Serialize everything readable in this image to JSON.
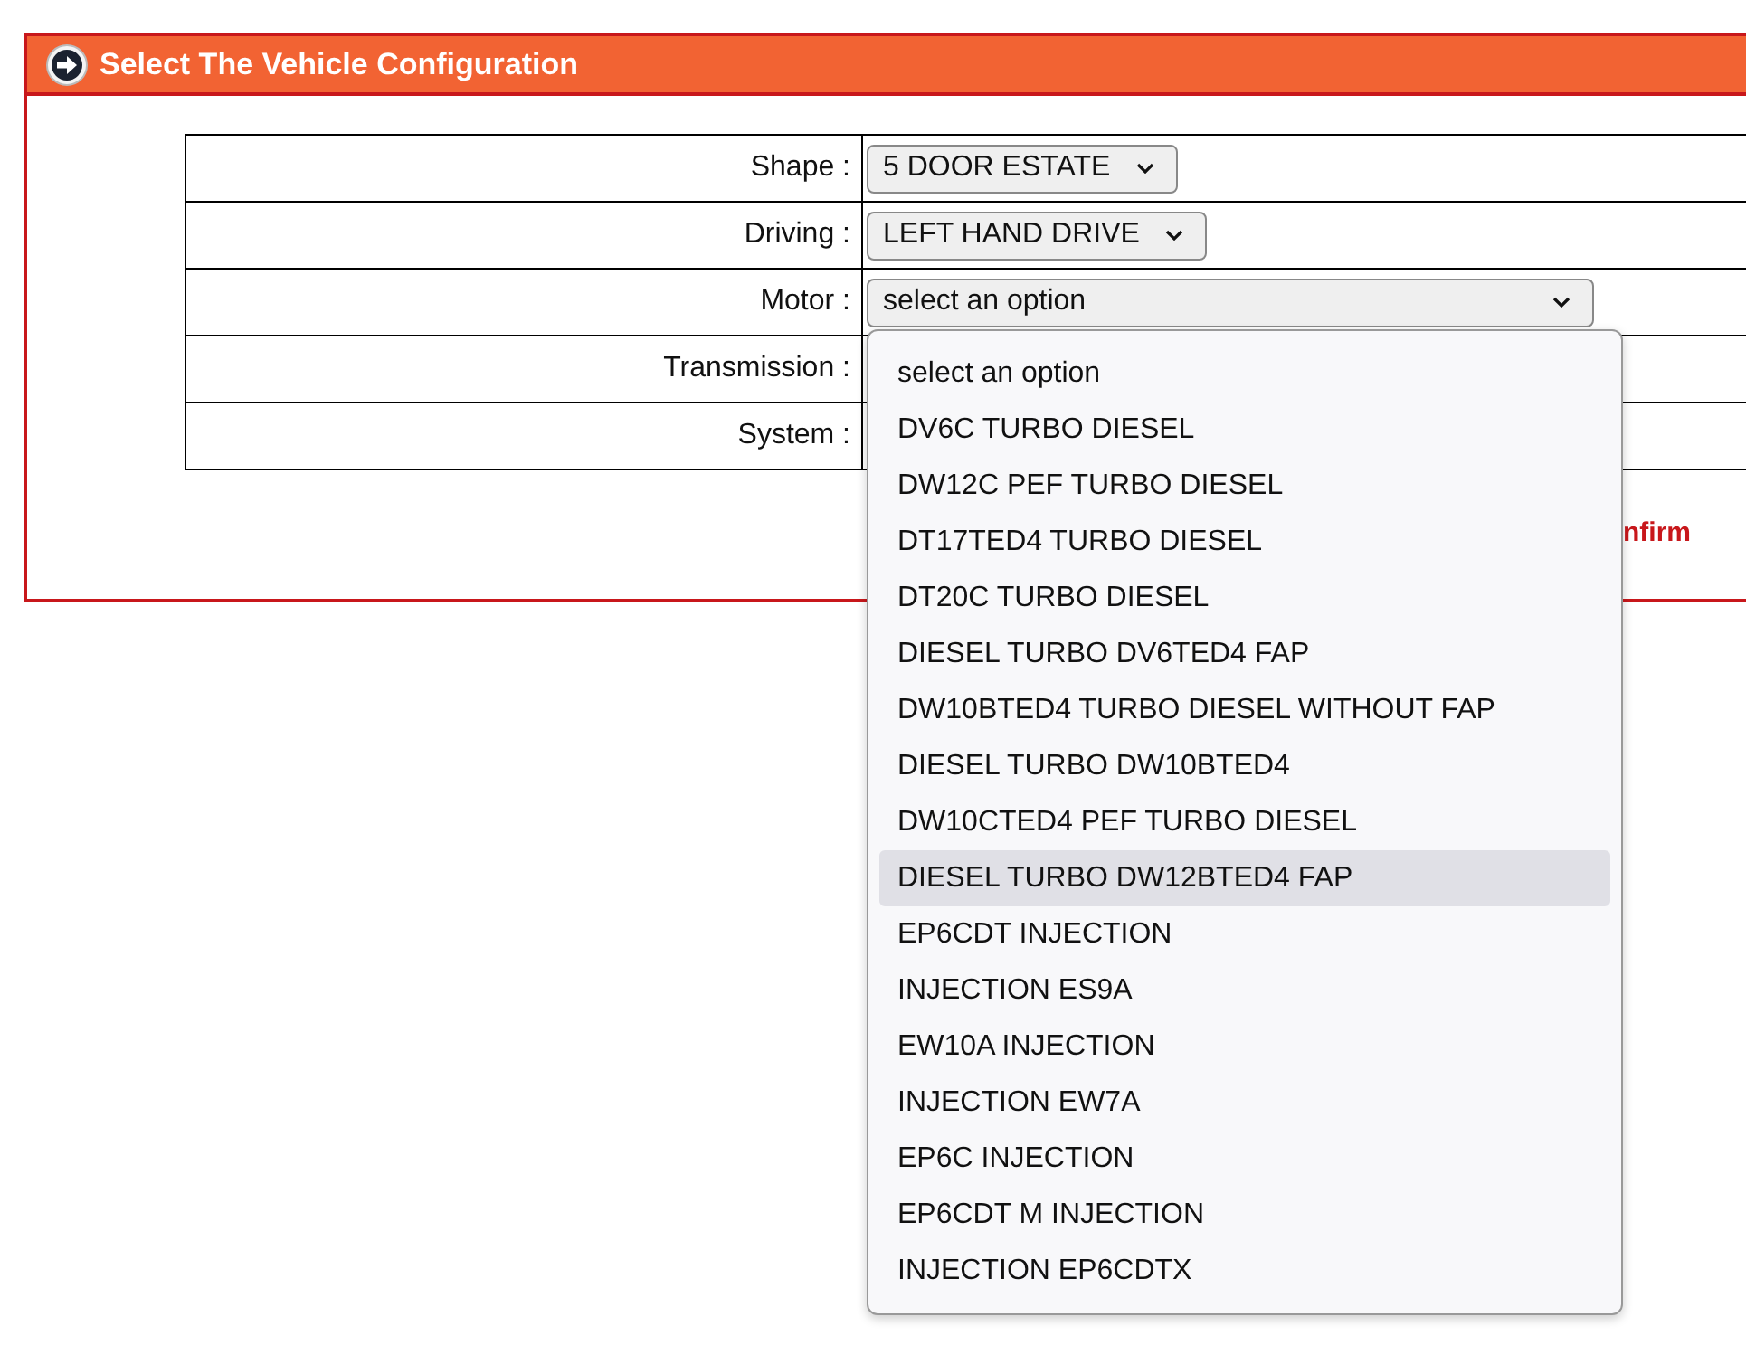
{
  "panel": {
    "title": "Select The Vehicle Configuration"
  },
  "rows": [
    {
      "label": "Shape :",
      "value": "5 DOOR ESTATE",
      "expanded": false
    },
    {
      "label": "Driving :",
      "value": "LEFT HAND DRIVE",
      "expanded": false
    },
    {
      "label": "Motor :",
      "value": "select an option",
      "expanded": true,
      "options": [
        {
          "text": "select an option",
          "highlighted": false
        },
        {
          "text": "DV6C TURBO DIESEL",
          "highlighted": false
        },
        {
          "text": "DW12C PEF TURBO DIESEL",
          "highlighted": false
        },
        {
          "text": "DT17TED4 TURBO DIESEL",
          "highlighted": false
        },
        {
          "text": "DT20C TURBO DIESEL",
          "highlighted": false
        },
        {
          "text": "DIESEL TURBO DV6TED4 FAP",
          "highlighted": false
        },
        {
          "text": "DW10BTED4 TURBO DIESEL WITHOUT FAP",
          "highlighted": false
        },
        {
          "text": "DIESEL TURBO DW10BTED4",
          "highlighted": false
        },
        {
          "text": "DW10CTED4 PEF TURBO DIESEL",
          "highlighted": false
        },
        {
          "text": "DIESEL TURBO DW12BTED4 FAP",
          "highlighted": true
        },
        {
          "text": "EP6CDT INJECTION",
          "highlighted": false
        },
        {
          "text": "INJECTION ES9A",
          "highlighted": false
        },
        {
          "text": "EW10A INJECTION",
          "highlighted": false
        },
        {
          "text": "INJECTION EW7A",
          "highlighted": false
        },
        {
          "text": "EP6C INJECTION",
          "highlighted": false
        },
        {
          "text": "EP6CDT M INJECTION",
          "highlighted": false
        },
        {
          "text": "INJECTION EP6CDTX",
          "highlighted": false
        }
      ]
    },
    {
      "label": "Transmission :"
    },
    {
      "label": "System :"
    }
  ],
  "confirm_link": "nfirm"
}
